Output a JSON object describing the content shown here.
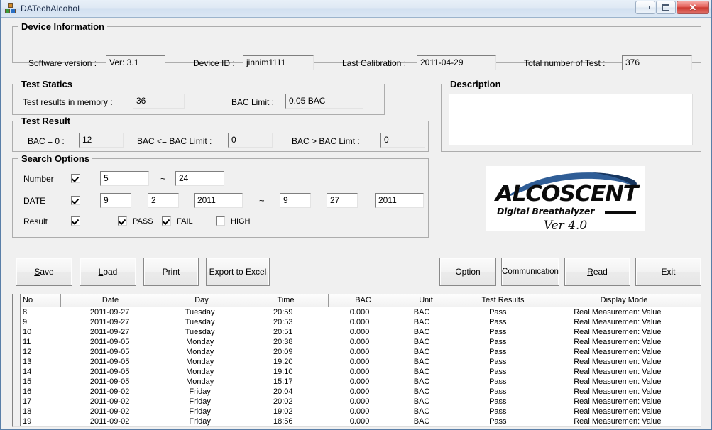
{
  "window": {
    "title": "DATechAlcohol",
    "icon": "app-blocks-icon",
    "buttons": {
      "minimize": "minimize-icon",
      "maximize": "maximize-icon",
      "close": "✕"
    }
  },
  "device_information": {
    "legend": "Device Information",
    "fields": [
      {
        "label": "Software version :",
        "value": "Ver: 3.1"
      },
      {
        "label": "Device ID :",
        "value": "jinnim1111"
      },
      {
        "label": "Last Calibration :",
        "value": "2011-04-29"
      },
      {
        "label": "Total number of Test :",
        "value": "376"
      }
    ]
  },
  "test_statics": {
    "legend": "Test Statics",
    "fields": [
      {
        "label": "Test results in memory :",
        "value": "36"
      },
      {
        "label": "BAC Limit :",
        "value": "0.05 BAC"
      }
    ]
  },
  "test_result": {
    "legend": "Test Result",
    "fields": [
      {
        "label": "BAC = 0  :",
        "value": "12"
      },
      {
        "label": "BAC <= BAC Limit  :",
        "value": "0"
      },
      {
        "label": "BAC  > BAC Limt :",
        "value": "0"
      }
    ]
  },
  "search_options": {
    "legend": "Search Options",
    "number": {
      "label": "Number",
      "enabled": true,
      "from": "5",
      "to": "24",
      "separator": "~"
    },
    "date": {
      "label": "DATE",
      "enabled": true,
      "from_month": "9",
      "from_day": "2",
      "from_year": "2011",
      "separator": "~",
      "to_month": "9",
      "to_day": "27",
      "to_year": "2011"
    },
    "result": {
      "label": "Result",
      "enabled": true,
      "options": [
        {
          "label": "PASS",
          "checked": true
        },
        {
          "label": "FAIL",
          "checked": true
        },
        {
          "label": "HIGH",
          "checked": false
        }
      ]
    }
  },
  "description": {
    "legend": "Description",
    "value": "",
    "placeholder": ""
  },
  "logo": {
    "brand": "ALCOSCENT",
    "tagline": "Digital Breathalyzer",
    "version": "Ver 4.0",
    "swoosh_color": "#2f5d96",
    "swoosh_color_dark": "#16355e"
  },
  "buttons_left": [
    {
      "label": "Save",
      "accel": "S"
    },
    {
      "label": "Load",
      "accel": "L"
    },
    {
      "label": "Print",
      "accel": ""
    },
    {
      "label": "Export to Excel",
      "accel": ""
    }
  ],
  "buttons_right": [
    {
      "label": "Option",
      "accel": ""
    },
    {
      "label": "Communication",
      "accel": ""
    },
    {
      "label": "Read",
      "accel": "R"
    },
    {
      "label": "Exit",
      "accel": ""
    }
  ],
  "results_table": {
    "columns": [
      "No",
      "Date",
      "Day",
      "Time",
      "BAC",
      "Unit",
      "Test Results",
      "Display Mode",
      ""
    ],
    "rows": [
      [
        "8",
        "2011-09-27",
        "Tuesday",
        "20:59",
        "0.000",
        "BAC",
        "Pass",
        "Real Measuremen: Value",
        ""
      ],
      [
        "9",
        "2011-09-27",
        "Tuesday",
        "20:53",
        "0.000",
        "BAC",
        "Pass",
        "Real Measuremen: Value",
        ""
      ],
      [
        "10",
        "2011-09-27",
        "Tuesday",
        "20:51",
        "0.000",
        "BAC",
        "Pass",
        "Real Measuremen: Value",
        ""
      ],
      [
        "11",
        "2011-09-05",
        "Monday",
        "20:38",
        "0.000",
        "BAC",
        "Pass",
        "Real Measuremen: Value",
        ""
      ],
      [
        "12",
        "2011-09-05",
        "Monday",
        "20:09",
        "0.000",
        "BAC",
        "Pass",
        "Real Measuremen: Value",
        ""
      ],
      [
        "13",
        "2011-09-05",
        "Monday",
        "19:20",
        "0.000",
        "BAC",
        "Pass",
        "Real Measuremen: Value",
        ""
      ],
      [
        "14",
        "2011-09-05",
        "Monday",
        "19:10",
        "0.000",
        "BAC",
        "Pass",
        "Real Measuremen: Value",
        ""
      ],
      [
        "15",
        "2011-09-05",
        "Monday",
        "15:17",
        "0.000",
        "BAC",
        "Pass",
        "Real Measuremen: Value",
        ""
      ],
      [
        "16",
        "2011-09-02",
        "Friday",
        "20:04",
        "0.000",
        "BAC",
        "Pass",
        "Real Measuremen: Value",
        ""
      ],
      [
        "17",
        "2011-09-02",
        "Friday",
        "20:02",
        "0.000",
        "BAC",
        "Pass",
        "Real Measuremen: Value",
        ""
      ],
      [
        "18",
        "2011-09-02",
        "Friday",
        "19:02",
        "0.000",
        "BAC",
        "Pass",
        "Real Measuremen: Value",
        ""
      ],
      [
        "19",
        "2011-09-02",
        "Friday",
        "18:56",
        "0.000",
        "BAC",
        "Pass",
        "Real Measuremen: Value",
        ""
      ]
    ]
  }
}
